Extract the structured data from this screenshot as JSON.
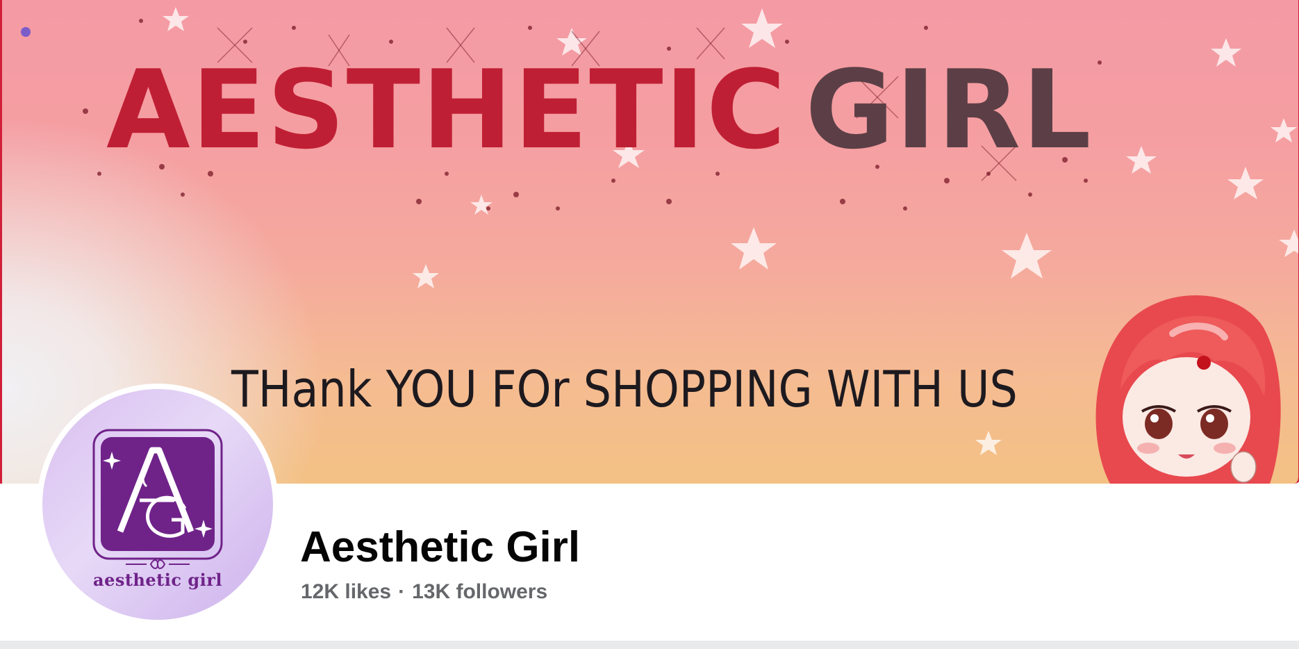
{
  "cover": {
    "headline_word1": "AESTHETIC",
    "headline_word2": "GIRL",
    "tagline": "THank YOU FOr SHOPPING WITH US"
  },
  "profile": {
    "logo_text": "aesthetic girl"
  },
  "page": {
    "name": "Aesthetic Girl",
    "likes": "12K likes",
    "separator": "·",
    "followers": "13K followers"
  },
  "colors": {
    "headline_red": "#bf1f34",
    "headline_dark": "#5c3f46",
    "logo_purple": "#6f2389",
    "meta_gray": "#65676b"
  }
}
